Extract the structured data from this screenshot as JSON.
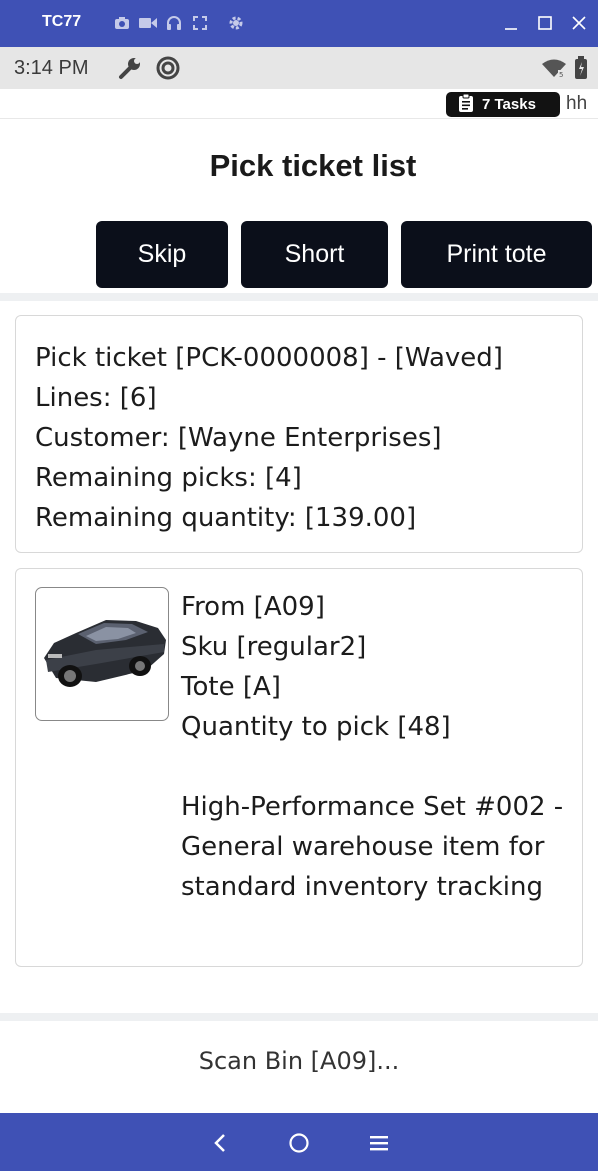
{
  "emulator": {
    "device_name": "TC77",
    "toolbar_icons": [
      "camera-icon",
      "video-icon",
      "headset-icon",
      "fullscreen-icon",
      "settings-icon"
    ],
    "window_controls": [
      "minimize-icon",
      "maximize-icon",
      "close-icon"
    ]
  },
  "status_bar": {
    "time": "3:14 PM",
    "left_icons": [
      "wrench-icon",
      "sync-icon"
    ],
    "right_icons": [
      "wifi-icon",
      "battery-icon"
    ]
  },
  "header": {
    "tasks_label": "7 Tasks",
    "tasks_icon": "clipboard-icon",
    "user_initials": "hh"
  },
  "page": {
    "title": "Pick ticket list"
  },
  "actions": {
    "skip": "Skip",
    "short": "Short",
    "print_tote": "Print tote"
  },
  "ticket": {
    "line1": "Pick ticket [PCK-0000008] - [Waved]",
    "line2": "Lines: [6]",
    "line3": "Customer: [Wayne Enterprises]",
    "line4": "Remaining picks: [4]",
    "line5": "Remaining quantity: [139.00]"
  },
  "pick": {
    "image": "car-thumbnail",
    "from": "From [A09]",
    "sku": "Sku [regular2]",
    "tote": "Tote [A]",
    "quantity": "Quantity to pick [48]",
    "description": "High-Performance Set #002 - General warehouse item for standard inventory tracking"
  },
  "scan": {
    "prompt": "Scan Bin [A09]..."
  },
  "nav": {
    "icons": [
      "back-icon",
      "home-icon",
      "menu-icon"
    ]
  },
  "colors": {
    "emulator_bar": "#3f51b5",
    "button_bg": "#0b0f1a",
    "status_bar": "#e6e6e6"
  }
}
